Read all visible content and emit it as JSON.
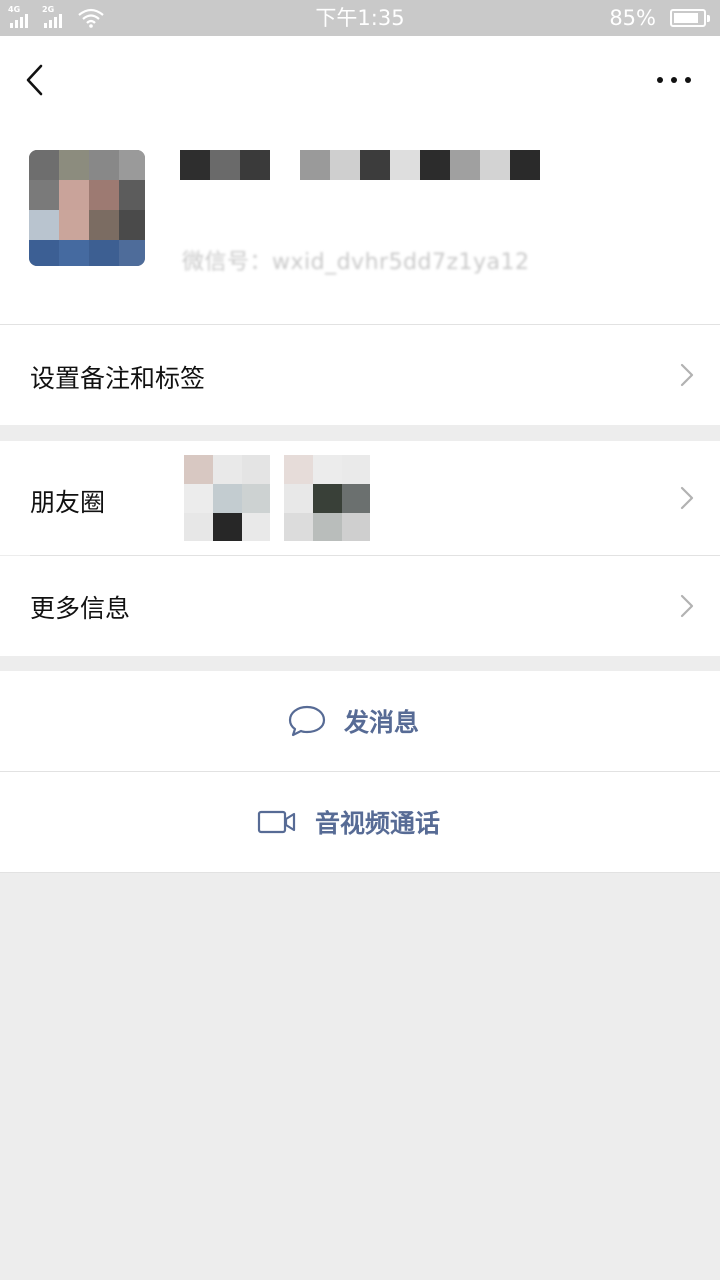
{
  "status_bar": {
    "network_1": "4G",
    "network_2": "2G",
    "time": "下午1:35",
    "battery_percent": "85%",
    "battery_level": 0.85
  },
  "header": {
    "back_icon": "chevron-left-icon",
    "more_icon": "more-dots-icon"
  },
  "profile": {
    "wechat_id": "微信号：wxid_dvhr5dd7z1ya12",
    "name_blurred": true
  },
  "rows": {
    "remark_tags": "设置备注和标签",
    "moments": "朋友圈",
    "more_info": "更多信息"
  },
  "actions": {
    "send_message": "发消息",
    "video_call": "音视频通话"
  },
  "colors": {
    "accent": "#576b95",
    "background": "#ededed",
    "status_bar": "#c9c9c9"
  }
}
